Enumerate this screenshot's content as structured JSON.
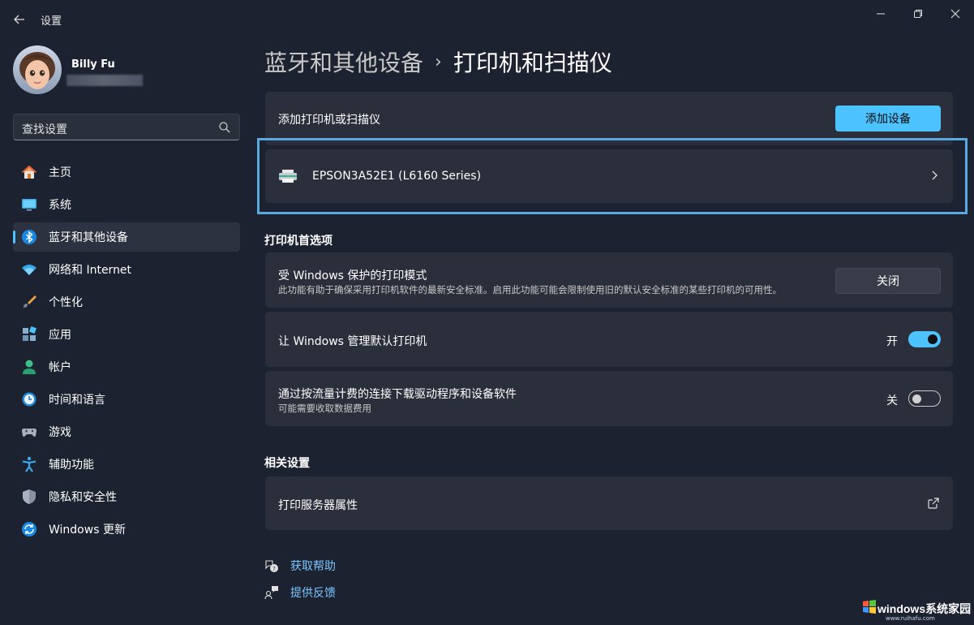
{
  "window": {
    "title": "设置"
  },
  "profile": {
    "name": "Billy Fu"
  },
  "search": {
    "placeholder": "查找设置"
  },
  "nav": {
    "items": [
      {
        "label": "主页",
        "icon": "home-icon"
      },
      {
        "label": "系统",
        "icon": "system-icon"
      },
      {
        "label": "蓝牙和其他设备",
        "icon": "bluetooth-icon",
        "active": true
      },
      {
        "label": "网络和 Internet",
        "icon": "wifi-icon"
      },
      {
        "label": "个性化",
        "icon": "brush-icon"
      },
      {
        "label": "应用",
        "icon": "apps-icon"
      },
      {
        "label": "帐户",
        "icon": "account-icon"
      },
      {
        "label": "时间和语言",
        "icon": "time-language-icon"
      },
      {
        "label": "游戏",
        "icon": "gaming-icon"
      },
      {
        "label": "辅助功能",
        "icon": "accessibility-icon"
      },
      {
        "label": "隐私和安全性",
        "icon": "shield-icon"
      },
      {
        "label": "Windows 更新",
        "icon": "update-icon"
      }
    ]
  },
  "breadcrumb": {
    "parent": "蓝牙和其他设备",
    "separator": "›",
    "current": "打印机和扫描仪"
  },
  "add_device": {
    "label": "添加打印机或扫描仪",
    "button": "添加设备"
  },
  "printers": [
    {
      "name": "EPSON3A52E1 (L6160 Series)"
    }
  ],
  "printer_prefs": {
    "title": "打印机首选项",
    "secure_mode": {
      "title": "受 Windows 保护的打印模式",
      "desc": "此功能有助于确保采用打印机软件的最新安全标准。启用此功能可能会限制使用旧的默认安全标准的某些打印机的可用性。",
      "button": "关闭"
    },
    "manage_default": {
      "title": "让 Windows 管理默认打印机",
      "state_label": "开",
      "on": true
    },
    "metered": {
      "title": "通过按流量计费的连接下载驱动程序和设备软件",
      "desc": "可能需要收取数据费用",
      "state_label": "关",
      "on": false
    }
  },
  "related": {
    "title": "相关设置",
    "print_server": "打印服务器属性"
  },
  "help": {
    "get_help": "获取帮助",
    "feedback": "提供反馈"
  },
  "watermark": {
    "name": "windows系统家园",
    "url": "www.ruihafu.com"
  },
  "colors": {
    "accent": "#4cc2ff",
    "background": "#1c2230",
    "card": "#2a2f3b",
    "highlight": "#5aa8e0"
  }
}
